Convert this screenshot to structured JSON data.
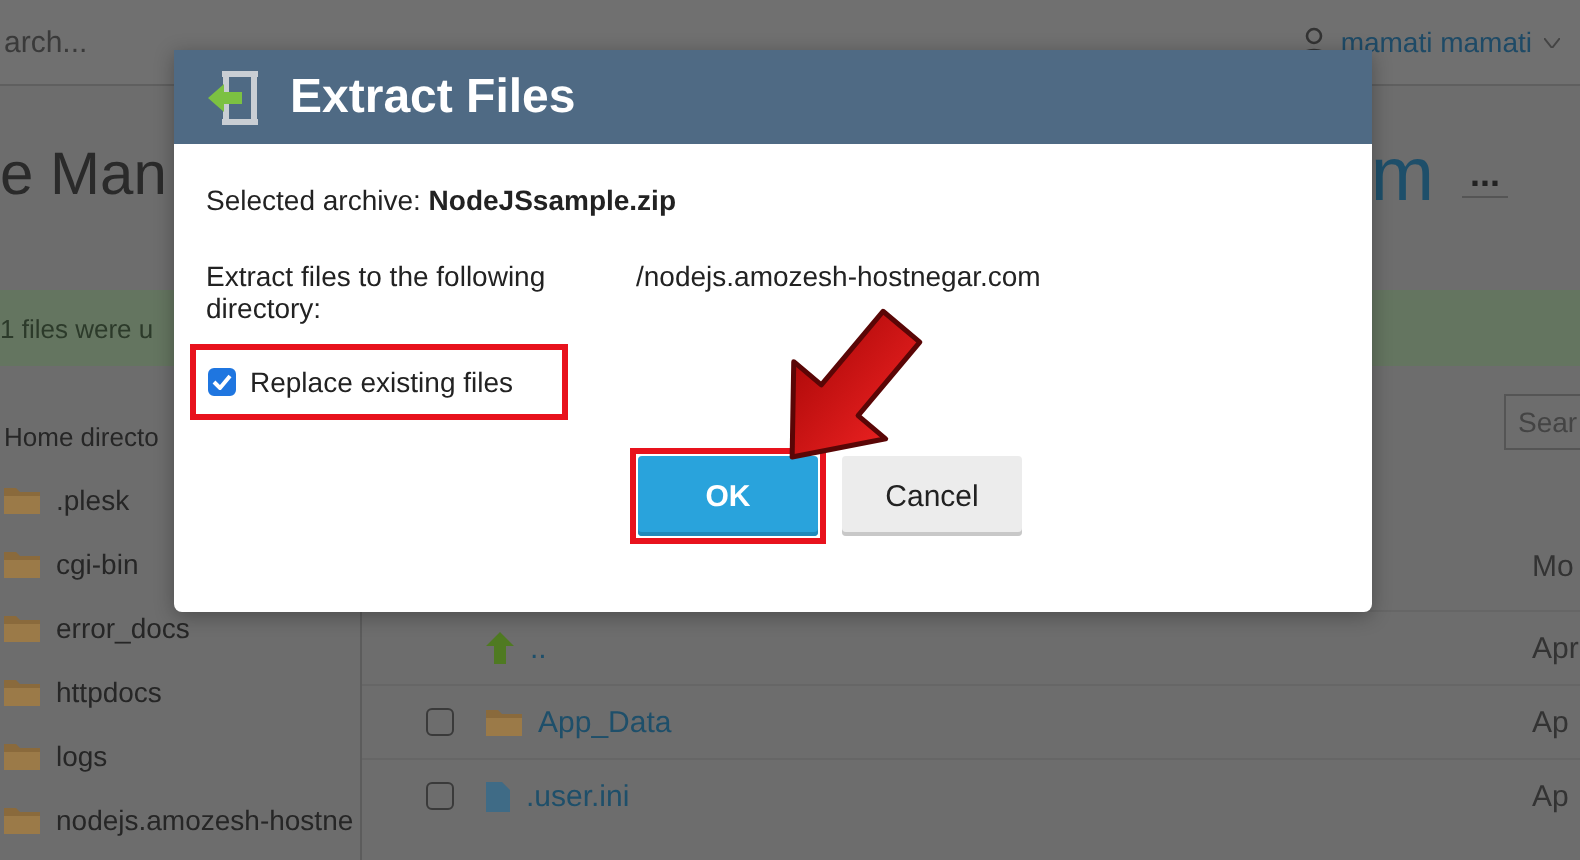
{
  "top_bar": {
    "search": {
      "placeholder": "arch..."
    },
    "user": "mamati mamati"
  },
  "page": {
    "title_left": "e Man",
    "title_right": "m",
    "more_button": "...",
    "banner": "1 files were u",
    "sidebar": {
      "heading": "Home directo",
      "items": [
        {
          "name": ".plesk"
        },
        {
          "name": "cgi-bin"
        },
        {
          "name": "error_docs"
        },
        {
          "name": "httpdocs"
        },
        {
          "name": "logs"
        },
        {
          "name": "nodejs.amozesh-hostne"
        }
      ]
    },
    "file_list": {
      "search": {
        "placeholder": "Sear"
      },
      "column_3": "Mo",
      "rows": [
        {
          "kind": "parent",
          "name": "..",
          "column_3": "Apr"
        },
        {
          "kind": "folder",
          "name": "App_Data",
          "column_3": "Ap",
          "checked": false
        },
        {
          "kind": "file",
          "name": ".user.ini",
          "column_3": "Ap",
          "checked": false
        }
      ]
    }
  },
  "dialog": {
    "title": "Extract Files",
    "archive": "Selected archive: **NodeJSsample.zip**",
    "directory_label": "Extract files to the following directory:",
    "directory": "/nodejs.amozesh-hostnegar.com",
    "replace": {
      "label": "Replace existing files",
      "checked": true,
      "highlighted": true
    },
    "buttons": [
      {
        "label": "OK",
        "kind": "primary",
        "highlighted": true
      },
      {
        "label": "Cancel",
        "kind": "secondary",
        "highlighted": false
      }
    ],
    "pointer_arrow": true
  }
}
